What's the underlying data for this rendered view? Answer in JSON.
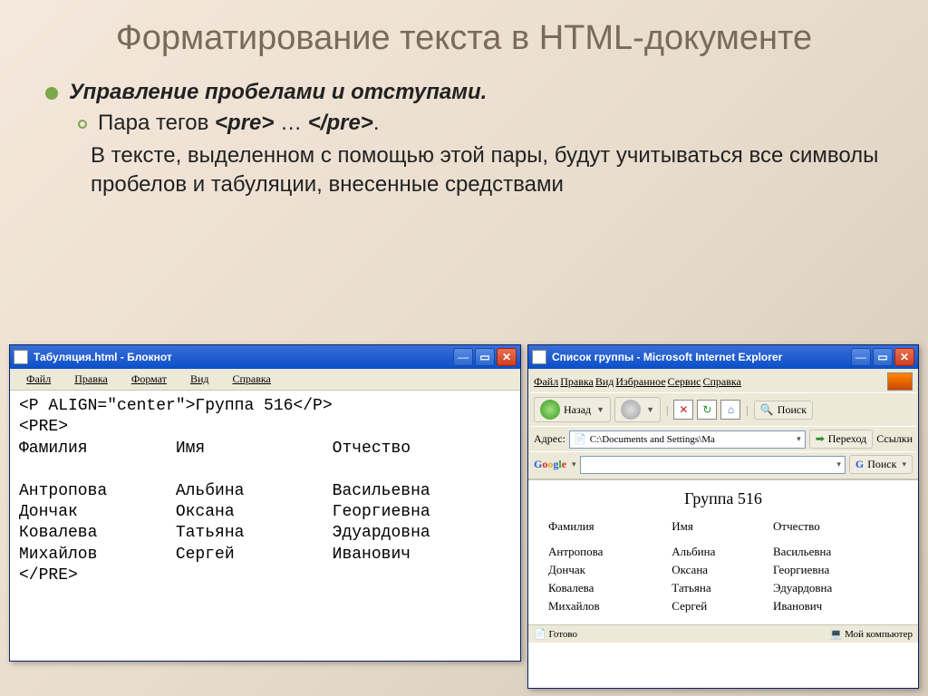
{
  "slide": {
    "title": "Форматирование текста в HTML-документе",
    "bullet1": "Управление пробелами и отступами.",
    "bullet2_prefix": "Пара тегов ",
    "bullet2_tag_open": "<pre>",
    "bullet2_mid": " … ",
    "bullet2_tag_close": "</pre>",
    "bullet2_suffix": ".",
    "para": "В тексте, выделенном с помощью этой пары, будут    учитываться все символы пробелов и табуляции,    внесенные средствами"
  },
  "notepad": {
    "title": "Табуляция.html - Блокнот",
    "menu": [
      "Файл",
      "Правка",
      "Формат",
      "Вид",
      "Справка"
    ],
    "code": "<P ALIGN=\"center\">Группа 516</P>\n<PRE>\nФамилия         Имя             Отчество\n\nАнтропова       Альбина         Васильевна\nДончак          Оксана          Георгиевна\nКовалева        Татьяна         Эдуардовна\nМихайлов        Сергей          Иванович\n</PRE>"
  },
  "ie": {
    "title": "Список группы - Microsoft Internet Explorer",
    "menu": [
      "Файл",
      "Правка",
      "Вид",
      "Избранное",
      "Сервис",
      "Справка"
    ],
    "back": "Назад",
    "search": "Поиск",
    "addr_label": "Адрес:",
    "addr_value": "C:\\Documents and Settings\\Ма",
    "go_label": "Переход",
    "links_label": "Ссылки",
    "google_search": "Поиск",
    "content_title": "Группа 516",
    "headers": [
      "Фамилия",
      "Имя",
      "Отчество"
    ],
    "rows": [
      [
        "Антропова",
        "Альбина",
        "Васильевна"
      ],
      [
        "Дончак",
        "Оксана",
        "Георгиевна"
      ],
      [
        "Ковалева",
        "Татьяна",
        "Эдуардовна"
      ],
      [
        "Михайлов",
        "Сергей",
        "Иванович"
      ]
    ],
    "status_ready": "Готово",
    "status_zone": "Мой компьютер"
  }
}
